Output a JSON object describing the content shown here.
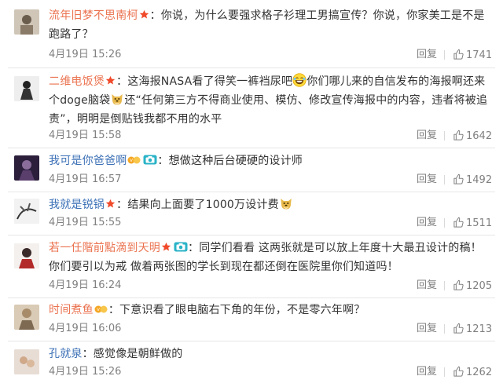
{
  "actions": {
    "reply_label": "回复"
  },
  "colors": {
    "username": "#eb7350",
    "username_blue": "#3d71b6",
    "meta": "#808080",
    "text": "#333333"
  },
  "comments": [
    {
      "user": "流年旧梦不思南柯",
      "text": "：你说，为什么要强求格子衫理工男搞宣传？你说，你家美工是不是跑路了？",
      "time": "4月19日 15:26",
      "likes": "1741"
    },
    {
      "user": "二维电饭煲",
      "text_a": "：这海报NASA看了得笑一裤裆尿吧",
      "text_b": "你们哪儿来的自信发布的海报啊还来个doge脑袋",
      "text_c": "还“任何第三方不得商业使用、模仿、修改宣传海报中的内容，违者将被追责”，明明是倒贴钱我都不用的水平",
      "time": "4月19日 15:58",
      "likes": "1642"
    },
    {
      "user": "我可是你爸爸啊",
      "text": "：想做这种后台硬硬的设计师",
      "time": "4月19日 16:57",
      "likes": "1492"
    },
    {
      "user": "我就是锐锅",
      "text": "：结果向上面要了1000万设计费",
      "time": "4月19日 15:55",
      "likes": "1511"
    },
    {
      "user": "若一任階前點滴到天明",
      "text": "：同学们看看 这两张就是可以放上年度十大最丑设计的稿！ 你们要引以为戒 做着两张图的学长到现在都还倒在医院里你们知道吗！",
      "time": "4月19日 16:24",
      "likes": "1205"
    },
    {
      "user": "时间煮鱼",
      "text": "：下意识看了眼电脑右下角的年份，不是零六年啊？",
      "time": "4月19日 16:06",
      "likes": "1213"
    },
    {
      "user": "孔就泉",
      "text": "：感觉像是朝鲜做的",
      "time": "4月19日 15:26",
      "likes": "1262"
    }
  ]
}
